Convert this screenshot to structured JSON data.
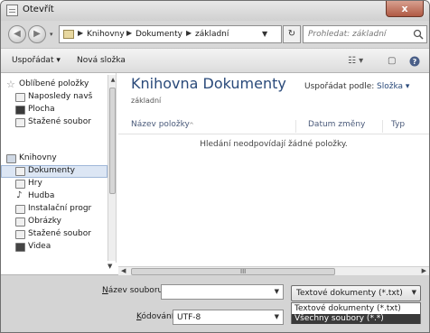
{
  "window": {
    "title": "Otevřít",
    "close_glyph": "x"
  },
  "navigation": {
    "back_icon": "back-arrow-icon",
    "forward_icon": "forward-arrow-icon",
    "breadcrumbs": [
      "Knihovny",
      "Dokumenty",
      "základní"
    ],
    "search_placeholder": "Prohledat: základní"
  },
  "toolbar": {
    "organize_label": "Uspořádat ▾",
    "new_folder_label": "Nová složka"
  },
  "sidebar": {
    "favorites_header": "Oblíbené položky",
    "favorites": [
      {
        "label": "Naposledy navš",
        "icon": "recent-places-icon"
      },
      {
        "label": "Plocha",
        "icon": "desktop-icon"
      },
      {
        "label": "Stažené soubor",
        "icon": "downloads-icon"
      }
    ],
    "libraries_header": "Knihovny",
    "libraries": [
      {
        "label": "Dokumenty",
        "icon": "documents-icon",
        "selected": true
      },
      {
        "label": "Hry",
        "icon": "games-icon"
      },
      {
        "label": "Hudba",
        "icon": "music-icon"
      },
      {
        "label": "Instalační progr",
        "icon": "installers-icon"
      },
      {
        "label": "Obrázky",
        "icon": "pictures-icon"
      },
      {
        "label": "Stažené soubor",
        "icon": "downloads-icon"
      },
      {
        "label": "Videa",
        "icon": "videos-icon"
      }
    ]
  },
  "main": {
    "library_title": "Knihovna Dokumenty",
    "library_subtitle": "základní",
    "arrange_label": "Uspořádat podle:",
    "arrange_value": "Složka ▾",
    "columns": [
      "Název položky",
      "Datum změny",
      "Typ"
    ],
    "empty_message": "Hledání neodpovídají žádné položky."
  },
  "footer": {
    "filename_label_accel": "N",
    "filename_label_rest": "ázev souboru:",
    "filename_value": "",
    "encoding_label_accel": "K",
    "encoding_label_rest": "ódování:",
    "encoding_value": "UTF-8",
    "filetype_selected": "Textové dokumenty (*.txt)",
    "filetype_options": [
      "Textové dokumenty (*.txt)",
      "Všechny soubory  (*.*)"
    ],
    "filetype_highlighted_index": 1
  },
  "colors": {
    "accent_text": "#2a4a7a",
    "highlight": "#3a3a3a"
  }
}
